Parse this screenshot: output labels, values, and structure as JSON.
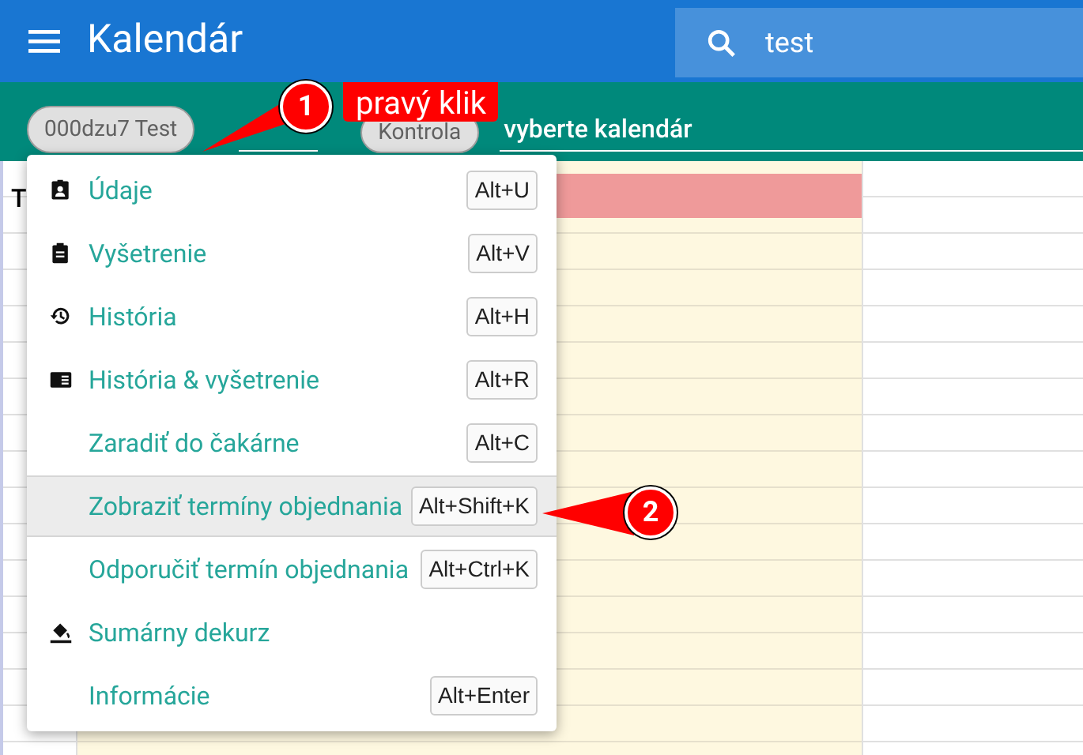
{
  "app_bar": {
    "title": "Kalendár",
    "search": {
      "value": "test"
    }
  },
  "toolbar": {
    "patient_chip": "000dzu7 Test",
    "status_chip": "Kontrola",
    "calendar_select": {
      "value": "vyberte kalendár"
    }
  },
  "grid": {
    "column_1_header": "T"
  },
  "context_menu": {
    "items": [
      {
        "label": "Údaje",
        "shortcut": "Alt+U",
        "selected": false
      },
      {
        "label": "Vyšetrenie",
        "shortcut": "Alt+V",
        "selected": false
      },
      {
        "label": "História",
        "shortcut": "Alt+H",
        "selected": false
      },
      {
        "label": "História & vyšetrenie",
        "shortcut": "Alt+R",
        "selected": false
      },
      {
        "label": "Zaradiť do čakárne",
        "shortcut": "Alt+C",
        "selected": false
      },
      {
        "label": "Zobraziť termíny objednania",
        "shortcut": "Alt+Shift+K",
        "selected": true
      },
      {
        "label": "Odporučiť termín objednania",
        "shortcut": "Alt+Ctrl+K",
        "selected": false
      },
      {
        "label": "Sumárny dekurz",
        "selected": false
      },
      {
        "label": "Informácie",
        "shortcut": "Alt+Enter",
        "selected": false
      }
    ]
  },
  "callouts": [
    {
      "number": "1",
      "label": "pravý klik"
    },
    {
      "number": "2"
    }
  ]
}
